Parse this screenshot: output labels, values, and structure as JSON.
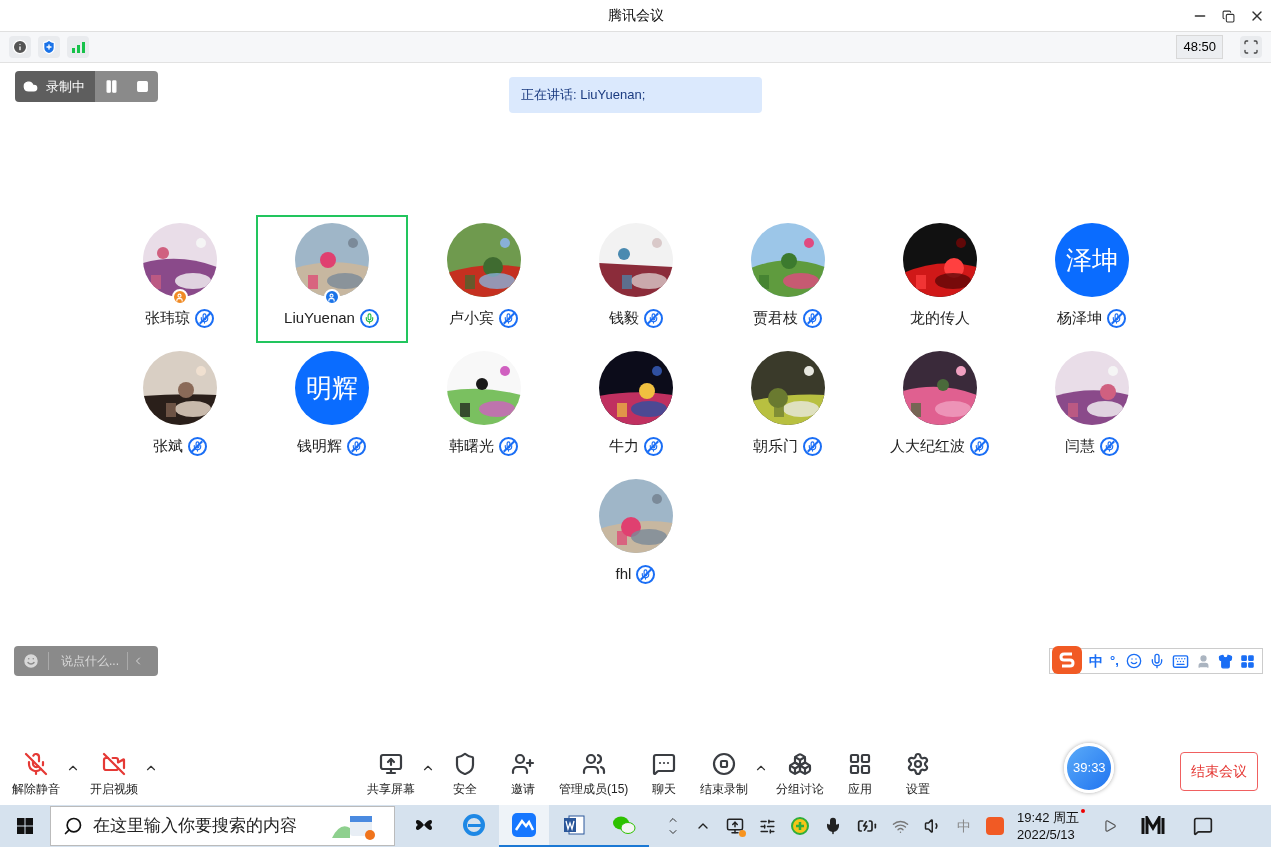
{
  "window": {
    "title": "腾讯会议"
  },
  "top_bar": {
    "elapsed": "48:50"
  },
  "recording": {
    "label": "录制中"
  },
  "speaking_banner": "正在讲话: LiuYuenan;",
  "participants": [
    {
      "name": "张玮琼",
      "badge": {
        "color": "#f08a24"
      },
      "speaking": false,
      "mic": true
    },
    {
      "name": "LiuYuenan",
      "badge": {
        "color": "#1a73e8"
      },
      "speaking": true,
      "mic": true
    },
    {
      "name": "卢小宾",
      "speaking": false,
      "mic": true
    },
    {
      "name": "钱毅",
      "speaking": false,
      "mic": true
    },
    {
      "name": "贾君枝",
      "speaking": false,
      "mic": true
    },
    {
      "name": "龙的传人",
      "speaking": false,
      "mic": false
    },
    {
      "name": "杨泽坤",
      "avatar": {
        "kind": "initials",
        "text": "泽坤"
      },
      "speaking": false,
      "mic": true
    },
    {
      "name": "张斌",
      "speaking": false,
      "mic": true
    },
    {
      "name": "钱明辉",
      "avatar": {
        "kind": "initials",
        "text": "明辉"
      },
      "speaking": false,
      "mic": true
    },
    {
      "name": "韩曙光",
      "speaking": false,
      "mic": true
    },
    {
      "name": "牛力",
      "speaking": false,
      "mic": true
    },
    {
      "name": "朝乐门",
      "speaking": false,
      "mic": true
    },
    {
      "name": "人大纪红波",
      "speaking": false,
      "mic": true
    },
    {
      "name": "闫慧",
      "speaking": false,
      "mic": true
    },
    {
      "name": "fhl",
      "speaking": false,
      "mic": true
    }
  ],
  "chat": {
    "placeholder": "说点什么..."
  },
  "ime_bar": {
    "mode": "中",
    "punctuation": "°,"
  },
  "toolbar": {
    "left": [
      {
        "kind": "mic_off",
        "label": "解除静音",
        "caret": true
      },
      {
        "kind": "video_off",
        "label": "开启视频",
        "caret": true
      }
    ],
    "center": [
      {
        "kind": "share",
        "label": "共享屏幕",
        "caret": true
      },
      {
        "kind": "security",
        "label": "安全",
        "caret": false
      },
      {
        "kind": "invite",
        "label": "邀请",
        "caret": false
      },
      {
        "kind": "members",
        "label": "管理成员(15)",
        "caret": false
      },
      {
        "kind": "chat",
        "label": "聊天",
        "caret": false
      },
      {
        "kind": "stop_record",
        "label": "结束录制",
        "caret": true
      },
      {
        "kind": "breakout",
        "label": "分组讨论",
        "caret": false
      },
      {
        "kind": "apps",
        "label": "应用",
        "caret": false
      },
      {
        "kind": "settings",
        "label": "设置",
        "caret": false
      }
    ],
    "timer": "39:33",
    "end_button": "结束会议"
  },
  "taskbar": {
    "search_placeholder": "在这里输入你要搜索的内容",
    "apps": [
      {
        "kind": "pinwheel",
        "running": false,
        "selected": false
      },
      {
        "kind": "browser",
        "running": false,
        "selected": false
      },
      {
        "kind": "meeting",
        "running": true,
        "selected": true
      },
      {
        "kind": "word",
        "running": true,
        "selected": false
      },
      {
        "kind": "wechat",
        "running": true,
        "selected": false
      }
    ],
    "tray_ime": "中",
    "time": "19:42 周五",
    "date": "2022/5/13"
  }
}
